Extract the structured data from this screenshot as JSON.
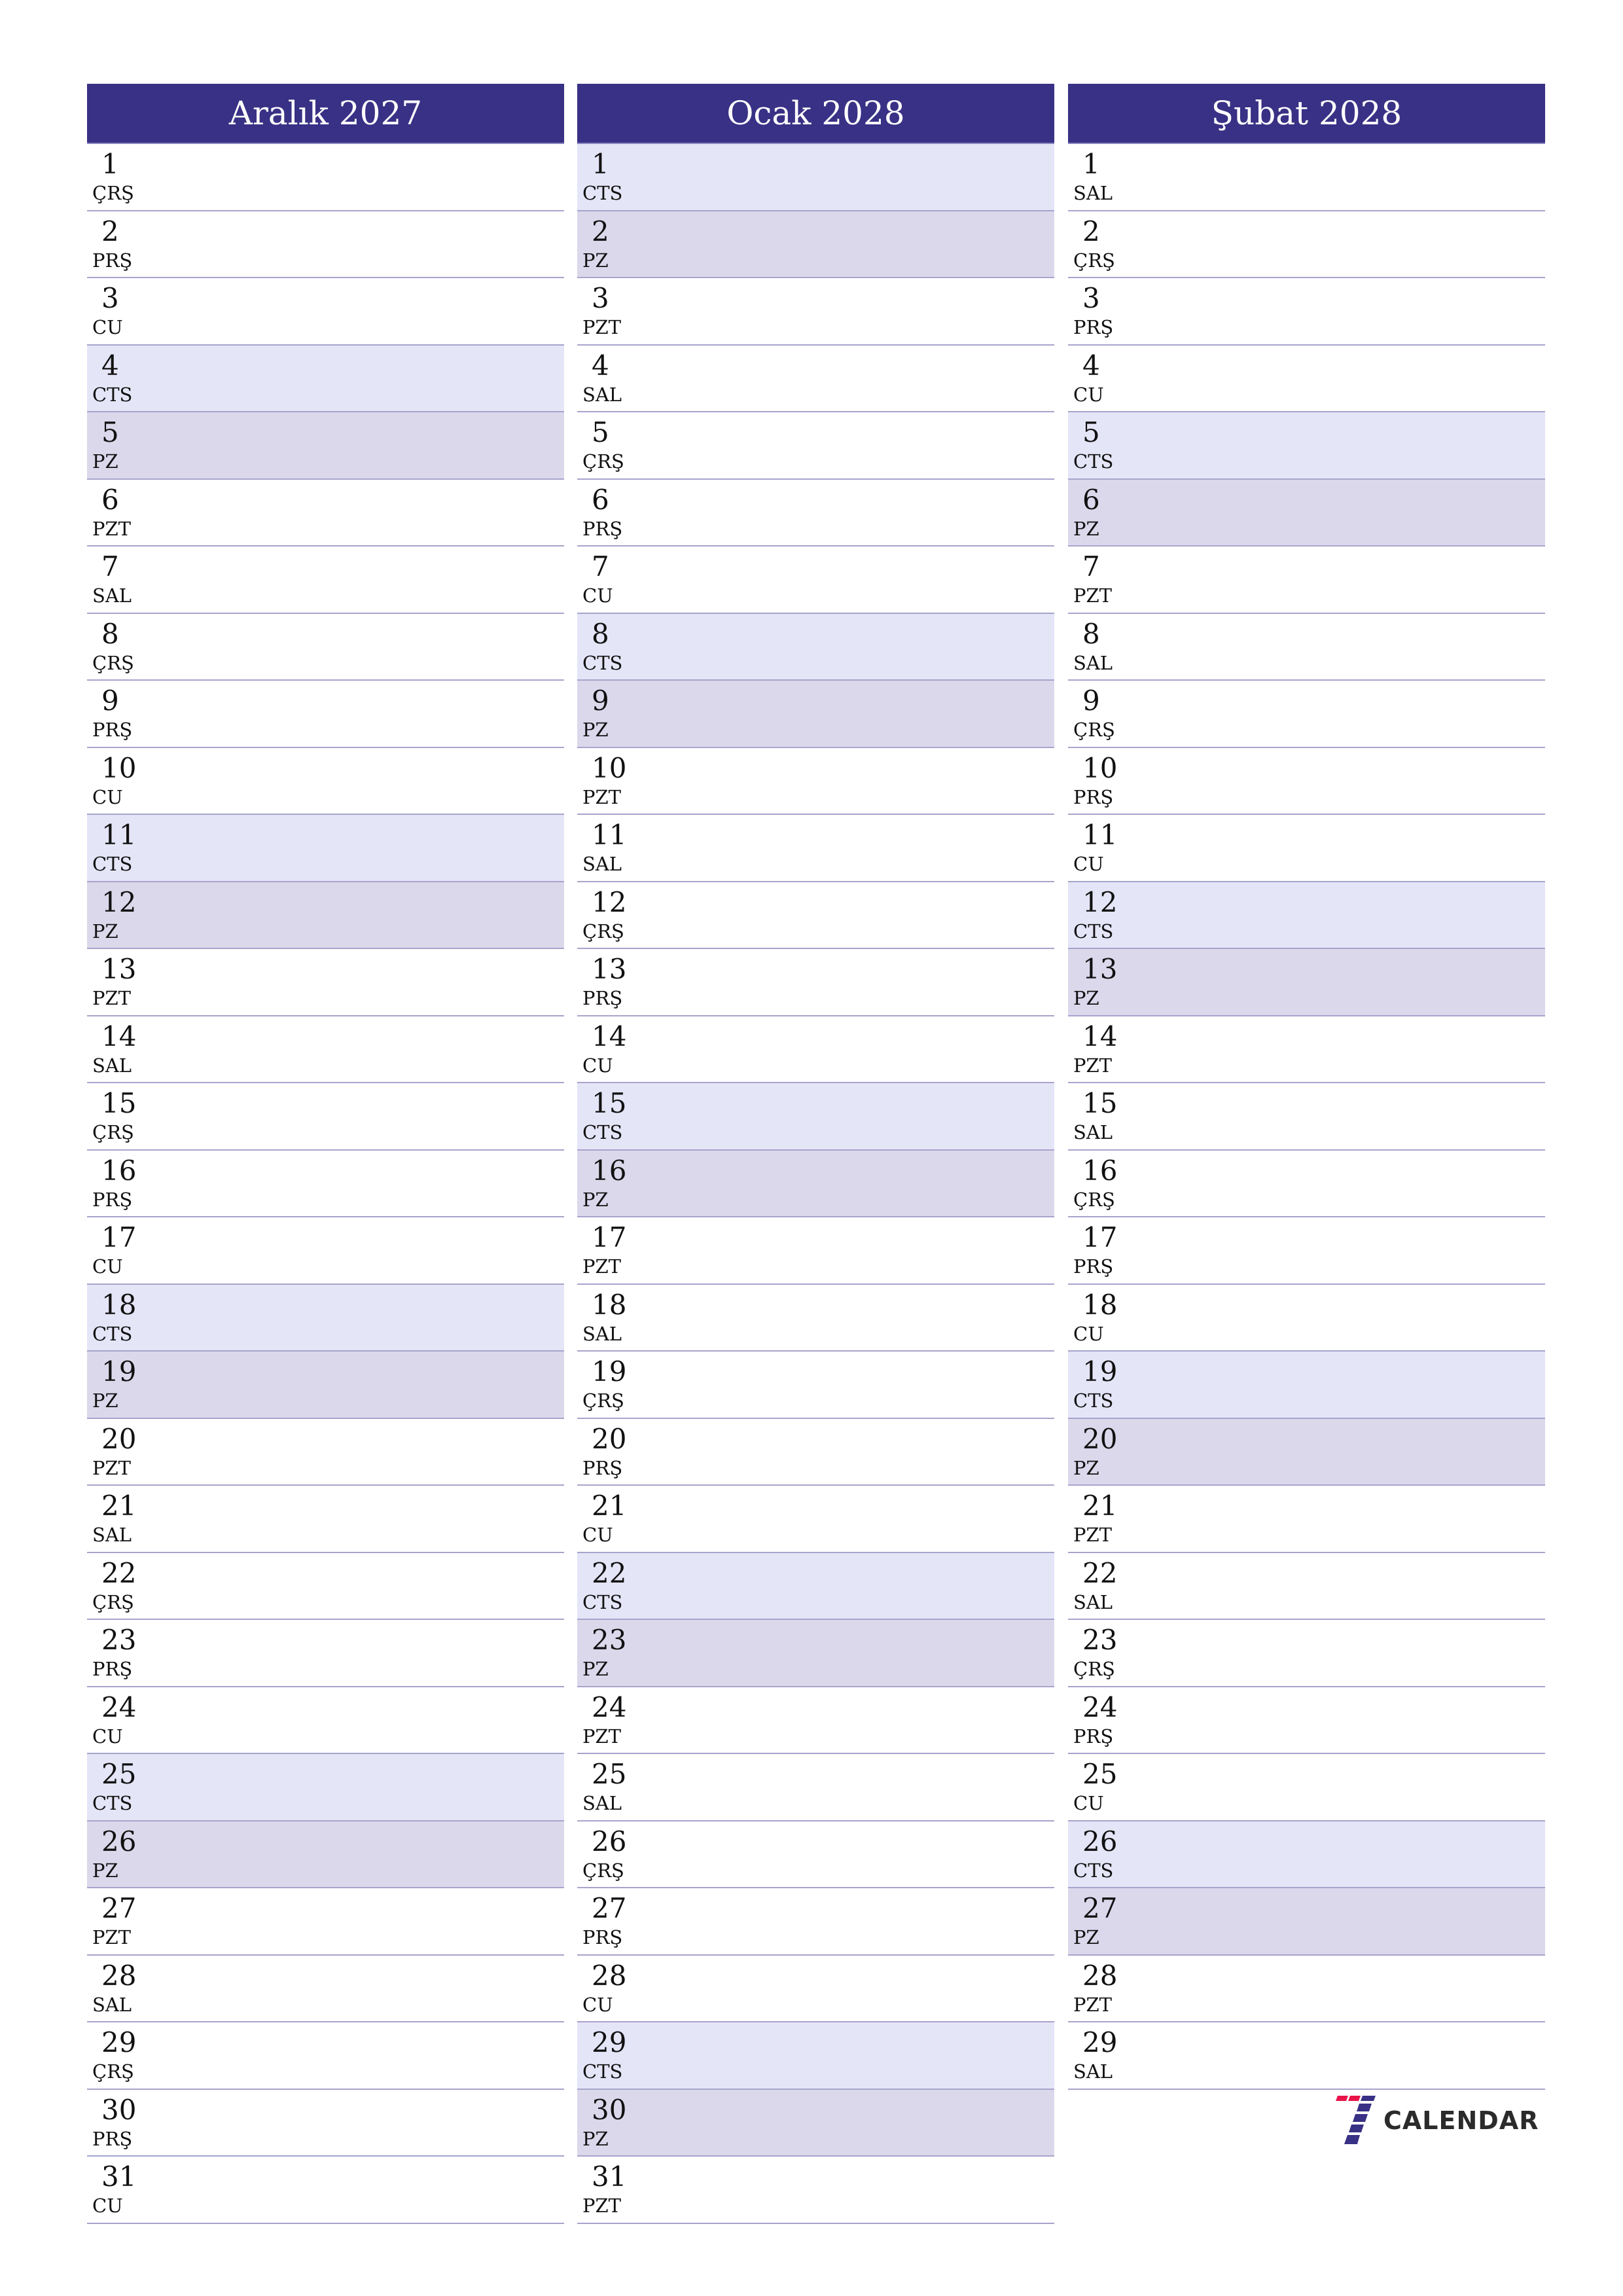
{
  "months": [
    {
      "title": "Aralık 2027",
      "days": [
        {
          "d": "1",
          "w": "ÇRŞ"
        },
        {
          "d": "2",
          "w": "PRŞ"
        },
        {
          "d": "3",
          "w": "CU"
        },
        {
          "d": "4",
          "w": "CTS"
        },
        {
          "d": "5",
          "w": "PZ"
        },
        {
          "d": "6",
          "w": "PZT"
        },
        {
          "d": "7",
          "w": "SAL"
        },
        {
          "d": "8",
          "w": "ÇRŞ"
        },
        {
          "d": "9",
          "w": "PRŞ"
        },
        {
          "d": "10",
          "w": "CU"
        },
        {
          "d": "11",
          "w": "CTS"
        },
        {
          "d": "12",
          "w": "PZ"
        },
        {
          "d": "13",
          "w": "PZT"
        },
        {
          "d": "14",
          "w": "SAL"
        },
        {
          "d": "15",
          "w": "ÇRŞ"
        },
        {
          "d": "16",
          "w": "PRŞ"
        },
        {
          "d": "17",
          "w": "CU"
        },
        {
          "d": "18",
          "w": "CTS"
        },
        {
          "d": "19",
          "w": "PZ"
        },
        {
          "d": "20",
          "w": "PZT"
        },
        {
          "d": "21",
          "w": "SAL"
        },
        {
          "d": "22",
          "w": "ÇRŞ"
        },
        {
          "d": "23",
          "w": "PRŞ"
        },
        {
          "d": "24",
          "w": "CU"
        },
        {
          "d": "25",
          "w": "CTS"
        },
        {
          "d": "26",
          "w": "PZ"
        },
        {
          "d": "27",
          "w": "PZT"
        },
        {
          "d": "28",
          "w": "SAL"
        },
        {
          "d": "29",
          "w": "ÇRŞ"
        },
        {
          "d": "30",
          "w": "PRŞ"
        },
        {
          "d": "31",
          "w": "CU"
        }
      ]
    },
    {
      "title": "Ocak 2028",
      "days": [
        {
          "d": "1",
          "w": "CTS"
        },
        {
          "d": "2",
          "w": "PZ"
        },
        {
          "d": "3",
          "w": "PZT"
        },
        {
          "d": "4",
          "w": "SAL"
        },
        {
          "d": "5",
          "w": "ÇRŞ"
        },
        {
          "d": "6",
          "w": "PRŞ"
        },
        {
          "d": "7",
          "w": "CU"
        },
        {
          "d": "8",
          "w": "CTS"
        },
        {
          "d": "9",
          "w": "PZ"
        },
        {
          "d": "10",
          "w": "PZT"
        },
        {
          "d": "11",
          "w": "SAL"
        },
        {
          "d": "12",
          "w": "ÇRŞ"
        },
        {
          "d": "13",
          "w": "PRŞ"
        },
        {
          "d": "14",
          "w": "CU"
        },
        {
          "d": "15",
          "w": "CTS"
        },
        {
          "d": "16",
          "w": "PZ"
        },
        {
          "d": "17",
          "w": "PZT"
        },
        {
          "d": "18",
          "w": "SAL"
        },
        {
          "d": "19",
          "w": "ÇRŞ"
        },
        {
          "d": "20",
          "w": "PRŞ"
        },
        {
          "d": "21",
          "w": "CU"
        },
        {
          "d": "22",
          "w": "CTS"
        },
        {
          "d": "23",
          "w": "PZ"
        },
        {
          "d": "24",
          "w": "PZT"
        },
        {
          "d": "25",
          "w": "SAL"
        },
        {
          "d": "26",
          "w": "ÇRŞ"
        },
        {
          "d": "27",
          "w": "PRŞ"
        },
        {
          "d": "28",
          "w": "CU"
        },
        {
          "d": "29",
          "w": "CTS"
        },
        {
          "d": "30",
          "w": "PZ"
        },
        {
          "d": "31",
          "w": "PZT"
        }
      ]
    },
    {
      "title": "Şubat 2028",
      "days": [
        {
          "d": "1",
          "w": "SAL"
        },
        {
          "d": "2",
          "w": "ÇRŞ"
        },
        {
          "d": "3",
          "w": "PRŞ"
        },
        {
          "d": "4",
          "w": "CU"
        },
        {
          "d": "5",
          "w": "CTS"
        },
        {
          "d": "6",
          "w": "PZ"
        },
        {
          "d": "7",
          "w": "PZT"
        },
        {
          "d": "8",
          "w": "SAL"
        },
        {
          "d": "9",
          "w": "ÇRŞ"
        },
        {
          "d": "10",
          "w": "PRŞ"
        },
        {
          "d": "11",
          "w": "CU"
        },
        {
          "d": "12",
          "w": "CTS"
        },
        {
          "d": "13",
          "w": "PZ"
        },
        {
          "d": "14",
          "w": "PZT"
        },
        {
          "d": "15",
          "w": "SAL"
        },
        {
          "d": "16",
          "w": "ÇRŞ"
        },
        {
          "d": "17",
          "w": "PRŞ"
        },
        {
          "d": "18",
          "w": "CU"
        },
        {
          "d": "19",
          "w": "CTS"
        },
        {
          "d": "20",
          "w": "PZ"
        },
        {
          "d": "21",
          "w": "PZT"
        },
        {
          "d": "22",
          "w": "SAL"
        },
        {
          "d": "23",
          "w": "ÇRŞ"
        },
        {
          "d": "24",
          "w": "PRŞ"
        },
        {
          "d": "25",
          "w": "CU"
        },
        {
          "d": "26",
          "w": "CTS"
        },
        {
          "d": "27",
          "w": "PZ"
        },
        {
          "d": "28",
          "w": "PZT"
        },
        {
          "d": "29",
          "w": "SAL"
        }
      ]
    }
  ],
  "weekend": {
    "saturday": "CTS",
    "sunday": "PZ"
  },
  "colors": {
    "header": "#393185",
    "saturday": "#e5e5f8",
    "sunday": "#dcd8ec",
    "logo_red": "#e8144a",
    "logo_blue": "#393185"
  },
  "logo": {
    "text": "CALENDAR",
    "icon": "seven-logo-icon"
  }
}
